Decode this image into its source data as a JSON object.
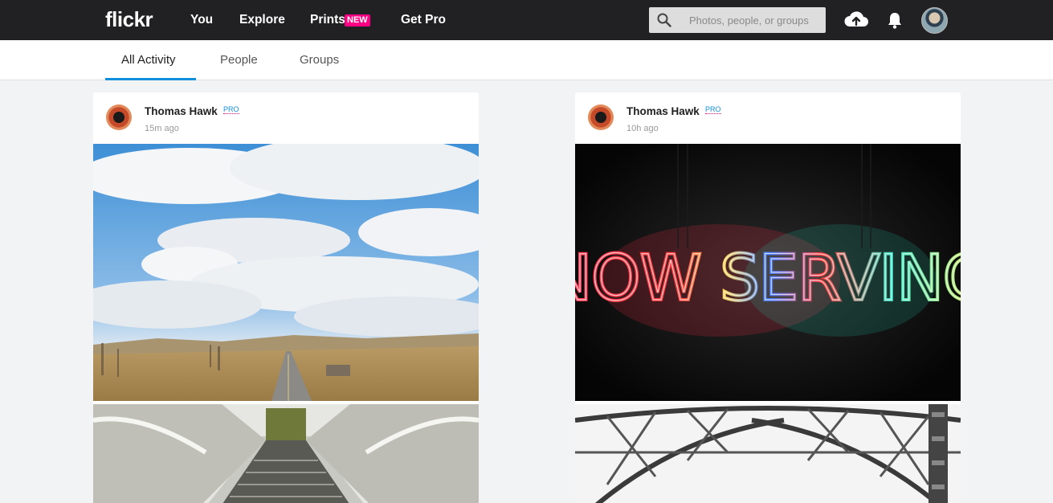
{
  "brand": {
    "logo": "flickr"
  },
  "nav": {
    "you": "You",
    "explore": "Explore",
    "prints": "Prints",
    "prints_badge": "NEW",
    "get_pro": "Get Pro"
  },
  "search": {
    "placeholder": "Photos, people, or groups",
    "value": ""
  },
  "tabs": [
    {
      "label": "All Activity",
      "active": true
    },
    {
      "label": "People",
      "active": false
    },
    {
      "label": "Groups",
      "active": false
    }
  ],
  "feed": [
    {
      "author": "Thomas Hawk",
      "badge": "PRO",
      "time": "15m ago",
      "photos": [
        "road-under-clouds-photo",
        "escalator-tunnel-photo"
      ]
    },
    {
      "author": "Thomas Hawk",
      "badge": "PRO",
      "time": "10h ago",
      "photos": [
        "now-serving-neon-sign-photo",
        "steel-bridge-truss-photo"
      ],
      "neon_text": "NOW SERVING"
    }
  ],
  "colors": {
    "topbar": "#212124",
    "accent_blue": "#128fdc",
    "accent_pink": "#ff0084"
  }
}
